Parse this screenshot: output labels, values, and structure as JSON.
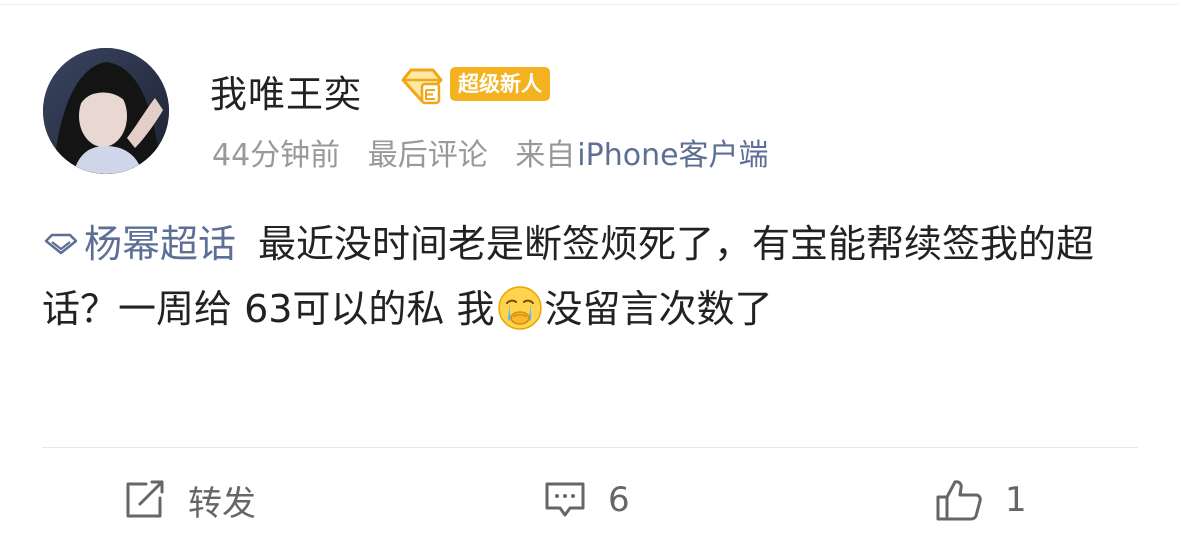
{
  "user": {
    "name": "我唯王奕",
    "badge": "超级新人"
  },
  "meta": {
    "time": "44分钟前",
    "status": "最后评论",
    "source_prefix": "来自",
    "source_device": "iPhone客户端"
  },
  "post": {
    "topic": "杨幂超话",
    "text_part1": "最近没时间老是断签烦死了，有宝能帮续签我的超话？一周给 63可以的私 我",
    "emoji": "crying-face-emoji",
    "text_part2": "没留言次数了"
  },
  "actions": {
    "repost_label": "转发",
    "comment_count": "6",
    "like_count": "1"
  },
  "colors": {
    "link": "#5d6f94",
    "badge": "#f4b221",
    "meta": "#999999",
    "text": "#222222"
  }
}
